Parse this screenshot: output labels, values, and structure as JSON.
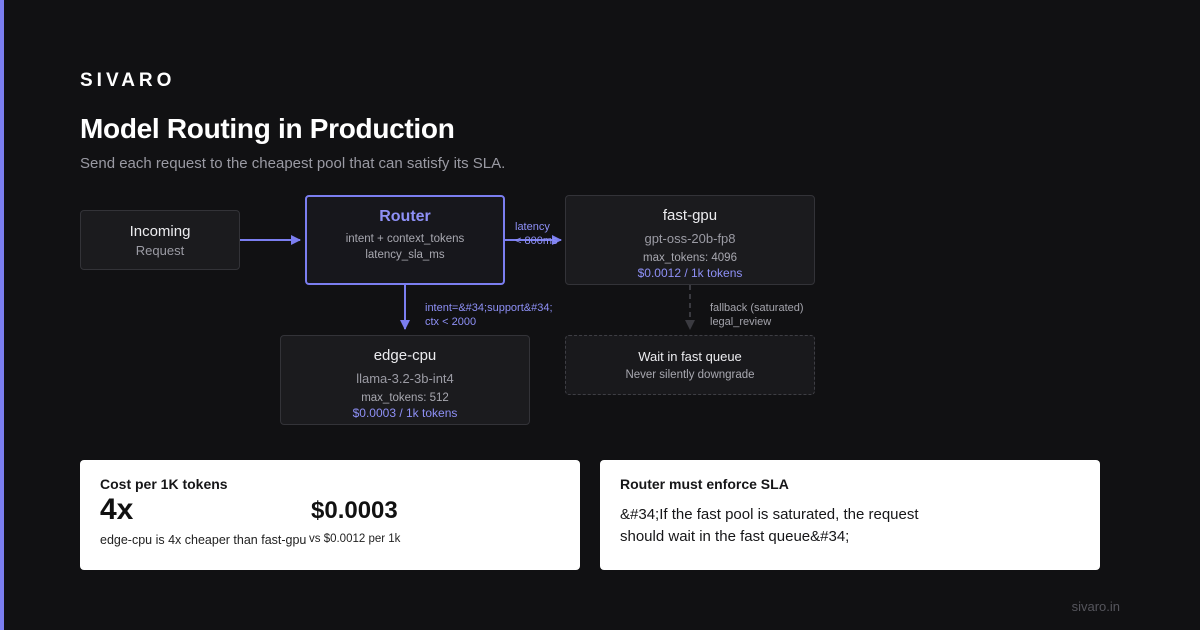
{
  "brand": "SIVARO",
  "title": "Model Routing in Production",
  "subtitle": "Send each request to the cheapest pool that can satisfy its SLA.",
  "nodes": {
    "incoming": {
      "title": "Incoming",
      "sub": "Request"
    },
    "router": {
      "title": "Router",
      "line1": "intent + context_tokens",
      "line2": "latency_sla_ms"
    },
    "fast_gpu": {
      "title": "fast-gpu",
      "model": "gpt-oss-20b-fp8",
      "max_tokens": "max_tokens: 4096",
      "price": "$0.0012 / 1k tokens"
    },
    "edge_cpu": {
      "title": "edge-cpu",
      "model": "llama-3.2-3b-int4",
      "max_tokens": "max_tokens: 512",
      "price": "$0.0003 / 1k tokens"
    },
    "wait": {
      "title": "Wait in fast queue",
      "sub": "Never silently downgrade"
    }
  },
  "edges": {
    "router_to_fast": {
      "line1": "latency",
      "line2": "< 800ms"
    },
    "router_to_edge": {
      "line1": "intent=&#34;support&#34;",
      "line2": "ctx < 2000"
    },
    "fast_to_wait": {
      "line1": "fallback (saturated)",
      "line2": "legal_review"
    }
  },
  "cards": {
    "cost": {
      "title": "Cost per 1K tokens",
      "big": "4x",
      "big_sub": "edge-cpu is 4x cheaper than fast-gpu",
      "value": "$0.0003",
      "value_sub": "vs $0.0012 per 1k"
    },
    "sla": {
      "title": "Router must enforce SLA",
      "quote_line1": "&#34;If the fast pool is saturated, the request",
      "quote_line2": "should wait in the fast queue&#34;"
    }
  },
  "footer": "sivaro.in",
  "colors": {
    "accent": "#7b7ef0",
    "background": "#111113",
    "card": "#ffffff"
  }
}
